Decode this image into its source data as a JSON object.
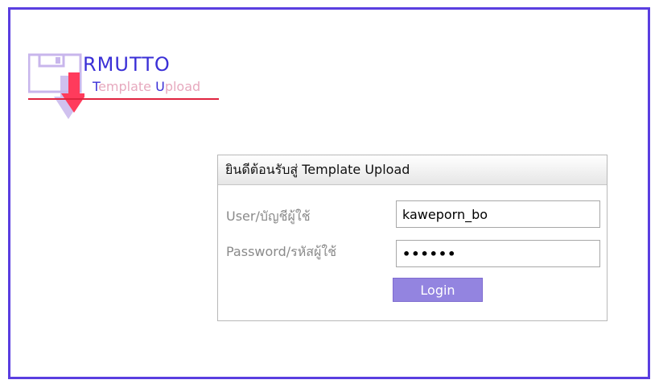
{
  "logo": {
    "title": "RMUTTO",
    "subtitle_t": "T",
    "subtitle_template": "emplate ",
    "subtitle_u": "U",
    "subtitle_upload": "pload",
    "icon": "floppy-download-icon",
    "colors": {
      "title": "#3a2fd6",
      "subtitle": "#e7a9be",
      "underline": "#e0243f",
      "arrow": "#ff3b5c"
    }
  },
  "login": {
    "header": "ยินดีต้อนรับสู่ Template Upload",
    "user_label": "User/บัญชีผู้ใช้",
    "user_value": "kaweporn_bo",
    "password_label": "Password/รหัสผู้ใช้",
    "password_value": "••••••",
    "button_label": "Login"
  },
  "colors": {
    "frame_border": "#5a3ee0",
    "button_bg": "#9384e0"
  }
}
